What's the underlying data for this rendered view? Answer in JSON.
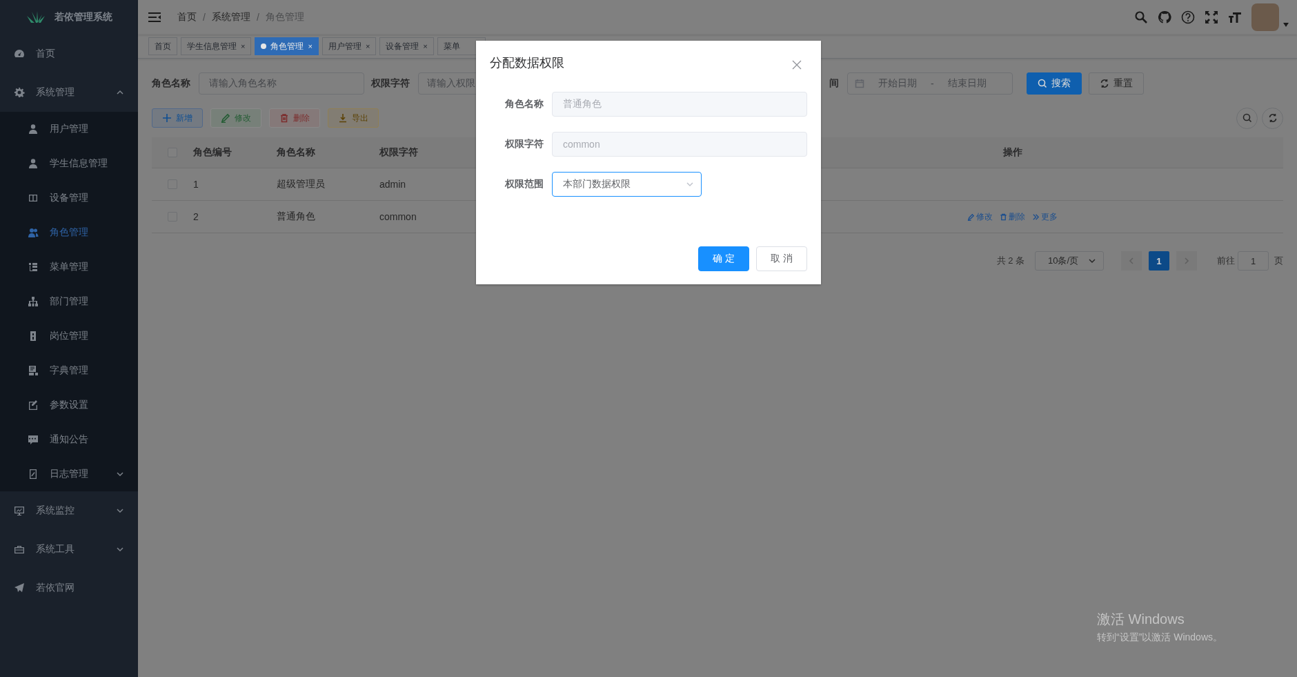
{
  "sidebar": {
    "logo_title": "若依管理系统",
    "items": [
      {
        "kind": "link",
        "label": "首页",
        "selected": false
      },
      {
        "kind": "group",
        "label": "系统管理",
        "selected": false,
        "expanded": true,
        "children": [
          {
            "kind": "link",
            "label": "用户管理",
            "selected": false
          },
          {
            "kind": "link",
            "label": "学生信息管理",
            "selected": false
          },
          {
            "kind": "link",
            "label": "设备管理",
            "selected": false
          },
          {
            "kind": "link",
            "label": "角色管理",
            "selected": true
          },
          {
            "kind": "link",
            "label": "菜单管理",
            "selected": false
          },
          {
            "kind": "link",
            "label": "部门管理",
            "selected": false
          },
          {
            "kind": "link",
            "label": "岗位管理",
            "selected": false
          },
          {
            "kind": "link",
            "label": "字典管理",
            "selected": false
          },
          {
            "kind": "link",
            "label": "参数设置",
            "selected": false
          },
          {
            "kind": "link",
            "label": "通知公告",
            "selected": false
          },
          {
            "kind": "group",
            "label": "日志管理",
            "selected": false,
            "expanded": false
          }
        ]
      },
      {
        "kind": "group",
        "label": "系统监控",
        "selected": false,
        "expanded": false
      },
      {
        "kind": "group",
        "label": "系统工具",
        "selected": false,
        "expanded": false
      },
      {
        "kind": "link",
        "label": "若依官网",
        "selected": false
      }
    ]
  },
  "header": {
    "breadcrumb": [
      {
        "label": "首页",
        "current": false
      },
      {
        "label": "系统管理",
        "current": false
      },
      {
        "label": "角色管理",
        "current": true
      }
    ],
    "separator": "/"
  },
  "tabs": [
    {
      "label": "首页",
      "selected": false
    },
    {
      "label": "学生信息管理",
      "selected": false,
      "close": "×"
    },
    {
      "label": "角色管理",
      "selected": true,
      "close": "×"
    },
    {
      "label": "用户管理",
      "selected": false,
      "close": "×"
    },
    {
      "label": "设备管理",
      "selected": false,
      "close": "×"
    },
    {
      "label": "菜单",
      "selected": false
    }
  ],
  "query": {
    "fields": [
      {
        "kind": "input",
        "label": "角色名称",
        "placeholder": "请输入角色名称"
      },
      {
        "kind": "input",
        "label": "权限字符",
        "placeholder": "请输入权限"
      },
      {
        "kind": "daterange",
        "label": "间",
        "start_placeholder": "开始日期",
        "separator": "-",
        "end_placeholder": "结束日期"
      }
    ],
    "buttons": [
      {
        "kind": "primary",
        "label": "搜索"
      },
      {
        "kind": "default",
        "label": "重置"
      }
    ]
  },
  "toolbar": [
    {
      "kind": "primary",
      "label": "新增",
      "disabled": false
    },
    {
      "kind": "success",
      "label": "修改",
      "disabled": true
    },
    {
      "kind": "danger",
      "label": "删除",
      "disabled": true
    },
    {
      "kind": "warning",
      "label": "导出",
      "disabled": false
    }
  ],
  "table": {
    "all_checked": false,
    "columns": [
      "角色编号",
      "角色名称",
      "权限字符",
      "操作"
    ],
    "rows": [
      {
        "checked": false,
        "cells": [
          "1",
          "超级管理员",
          "admin"
        ]
      },
      {
        "checked": false,
        "cells": [
          "2",
          "普通角色",
          "common"
        ],
        "actions": [
          "修改",
          "删除",
          "更多"
        ]
      }
    ]
  },
  "pagination": {
    "total": "共 2 条",
    "page_size": "10条/页",
    "pages": [
      {
        "label": "1",
        "selected": true
      }
    ],
    "goto_label": "前往",
    "goto_value": "1",
    "goto_suffix": "页"
  },
  "dialog": {
    "title": "分配数据权限",
    "fields": [
      {
        "kind": "input",
        "label": "角色名称",
        "value": "普通角色",
        "disabled": true
      },
      {
        "kind": "input",
        "label": "权限字符",
        "value": "common",
        "disabled": true
      },
      {
        "kind": "select",
        "label": "权限范围",
        "value": "本部门数据权限",
        "disabled": false
      }
    ],
    "buttons": [
      {
        "kind": "primary",
        "label": "确 定"
      },
      {
        "kind": "default",
        "label": "取 消"
      }
    ]
  },
  "os_notice": {
    "title": "激活 Windows",
    "subtitle": "转到“设置”以激活 Windows。"
  }
}
